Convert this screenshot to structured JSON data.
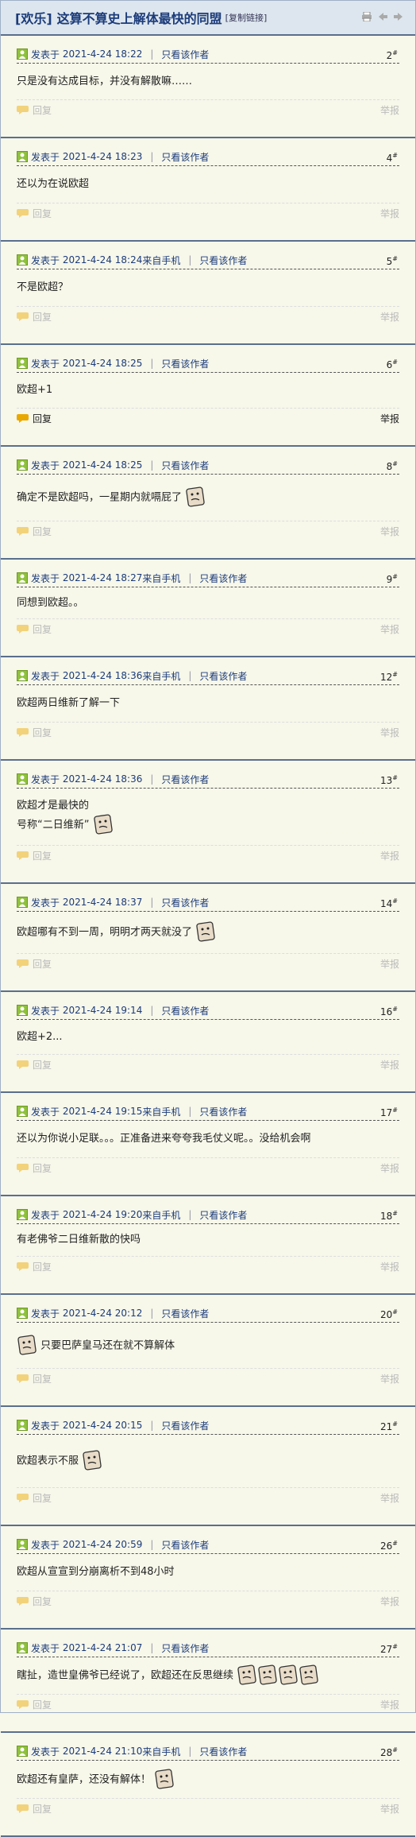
{
  "header": {
    "category": "[欢乐]",
    "title": "这算不算史上解体最快的同盟",
    "copy_link": "[复制链接]"
  },
  "labels": {
    "posted_prefix": "发表于",
    "only_author": "只看该作者",
    "from_mobile": "来自手机",
    "reply": "回复",
    "report": "举报"
  },
  "posts": [
    {
      "time": "2021-4-24 18:22",
      "mobile": false,
      "floor": "2",
      "lines": [
        "只是没有达成目标，并没有解散嘛……"
      ],
      "emoji_count": 0
    },
    {
      "time": "2021-4-24 18:23",
      "mobile": false,
      "floor": "4",
      "lines": [
        "还以为在说欧超"
      ],
      "emoji_count": 0
    },
    {
      "time": "2021-4-24 18:24",
      "mobile": true,
      "floor": "5",
      "lines": [
        "不是欧超？"
      ],
      "emoji_count": 0
    },
    {
      "time": "2021-4-24 18:25",
      "mobile": false,
      "floor": "6",
      "lines": [
        "欧超+1"
      ],
      "emoji_count": 0,
      "active": true
    },
    {
      "time": "2021-4-24 18:25",
      "mobile": false,
      "floor": "8",
      "lines": [
        "确定不是欧超吗，一星期内就嗝屁了"
      ],
      "emoji_count": 1
    },
    {
      "time": "2021-4-24 18:27",
      "mobile": true,
      "floor": "9",
      "lines": [
        "同想到欧超。。"
      ],
      "emoji_count": 0
    },
    {
      "time": "2021-4-24 18:36",
      "mobile": true,
      "floor": "12",
      "lines": [
        "欧超两日维新了解一下"
      ],
      "emoji_count": 0
    },
    {
      "time": "2021-4-24 18:36",
      "mobile": false,
      "floor": "13",
      "lines": [
        "欧超才是最快的",
        "号称“二日维新”"
      ],
      "emoji_count": 1
    },
    {
      "time": "2021-4-24 18:37",
      "mobile": false,
      "floor": "14",
      "lines": [
        "欧超哪有不到一周，明明才两天就没了"
      ],
      "emoji_count": 1
    },
    {
      "time": "2021-4-24 19:14",
      "mobile": false,
      "floor": "16",
      "lines": [
        "欧超+2..."
      ],
      "emoji_count": 0
    },
    {
      "time": "2021-4-24 19:15",
      "mobile": true,
      "floor": "17",
      "lines": [
        "还以为你说小足联。。。正准备进来夸夸我毛仗义呢。。没给机会啊"
      ],
      "emoji_count": 0
    },
    {
      "time": "2021-4-24 19:20",
      "mobile": true,
      "floor": "18",
      "lines": [
        "有老佛爷二日维新散的快吗"
      ],
      "emoji_count": 0
    },
    {
      "time": "2021-4-24 20:12",
      "mobile": false,
      "floor": "20",
      "lines": [
        "只要巴萨皇马还在就不算解体"
      ],
      "emoji_count": 1,
      "emoji_first": true
    },
    {
      "time": "2021-4-24 20:15",
      "mobile": false,
      "floor": "21",
      "lines": [
        "欧超表示不服"
      ],
      "emoji_count": 1
    },
    {
      "time": "2021-4-24 20:59",
      "mobile": false,
      "floor": "26",
      "lines": [
        "欧超从宣宣到分崩离析不到48小时"
      ],
      "emoji_count": 0
    },
    {
      "time": "2021-4-24 21:07",
      "mobile": false,
      "floor": "27",
      "lines": [
        "瞎扯，造世皇佛爷已经说了，欧超还在反思继续"
      ],
      "emoji_count": 4
    },
    {
      "time": "2021-4-24 21:10",
      "mobile": true,
      "floor": "28",
      "lines": [
        "欧超还有皇萨，还没有解体！"
      ],
      "emoji_count": 1
    }
  ],
  "colors": {
    "accent": "#1b3b7a",
    "border": "#5a6f8e",
    "background": "#f7f7ea",
    "avatar": "#8fc13d"
  }
}
